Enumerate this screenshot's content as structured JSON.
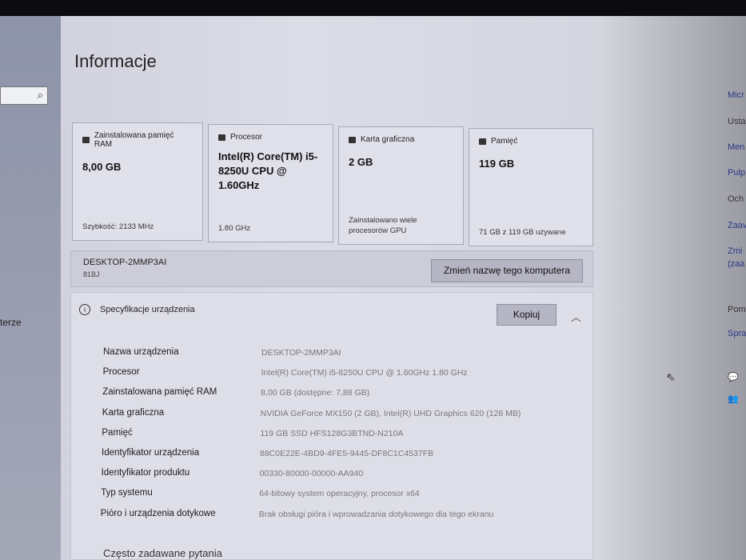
{
  "page": {
    "title": "Informacje"
  },
  "sidebar": {
    "search_icon": "search-icon",
    "partial_item": "terze"
  },
  "cards": [
    {
      "label": "Zainstalowana pamięć RAM",
      "value": "8,00 GB",
      "footer": "Szybkość: 2133 MHz",
      "icon": "ram-icon"
    },
    {
      "label": "Procesor",
      "value": "Intel(R) Core(TM) i5-8250U CPU @ 1.60GHz",
      "footer": "1.80 GHz",
      "icon": "cpu-icon"
    },
    {
      "label": "Karta graficzna",
      "value": "2 GB",
      "footer": "Zainstalowano wiele procesorów GPU",
      "icon": "gpu-icon"
    },
    {
      "label": "Pamięć",
      "value": "119 GB",
      "footer": "71 GB z 119 GB używane",
      "icon": "storage-icon"
    }
  ],
  "device": {
    "name": "DESKTOP-2MMP3AI",
    "model": "81BJ",
    "rename_button": "Zmień nazwę tego komputera"
  },
  "spec": {
    "title": "Specyfikacje urządzenia",
    "copy_button": "Kopiuj",
    "info_icon": "i",
    "rows": [
      {
        "label": "Nazwa urządzenia",
        "value": "DESKTOP-2MMP3AI"
      },
      {
        "label": "Procesor",
        "value": "Intel(R) Core(TM) i5-8250U CPU @ 1.60GHz   1.80 GHz"
      },
      {
        "label": "Zainstalowana pamięć RAM",
        "value": "8,00 GB (dostępne: 7,88 GB)"
      },
      {
        "label": "Karta graficzna",
        "value": "NVIDIA GeForce MX150 (2 GB), Intel(R) UHD Graphics 620 (128 MB)"
      },
      {
        "label": "Pamięć",
        "value": "119 GB SSD HFS128G3BTND-N210A"
      },
      {
        "label": "Identyfikator urządzenia",
        "value": "88C0E22E-4BD9-4FE5-9445-DF8C1C4537FB"
      },
      {
        "label": "Identyfikator produktu",
        "value": "00330-80000-00000-AA940"
      },
      {
        "label": "Typ systemu",
        "value": "64-bitowy system operacyjny, procesor x64"
      },
      {
        "label": "Pióro i urządzenia dotykowe",
        "value": "Brak obsługi pióra i wprowadzania dotykowego dla tego ekranu"
      }
    ]
  },
  "faq": "Często zadawane pytania",
  "right_links": [
    "Micr",
    "Usta",
    "Men",
    "Pulp",
    "Och",
    "Zaav",
    "Zmi",
    "(zaa",
    "Pom",
    "Spra"
  ]
}
